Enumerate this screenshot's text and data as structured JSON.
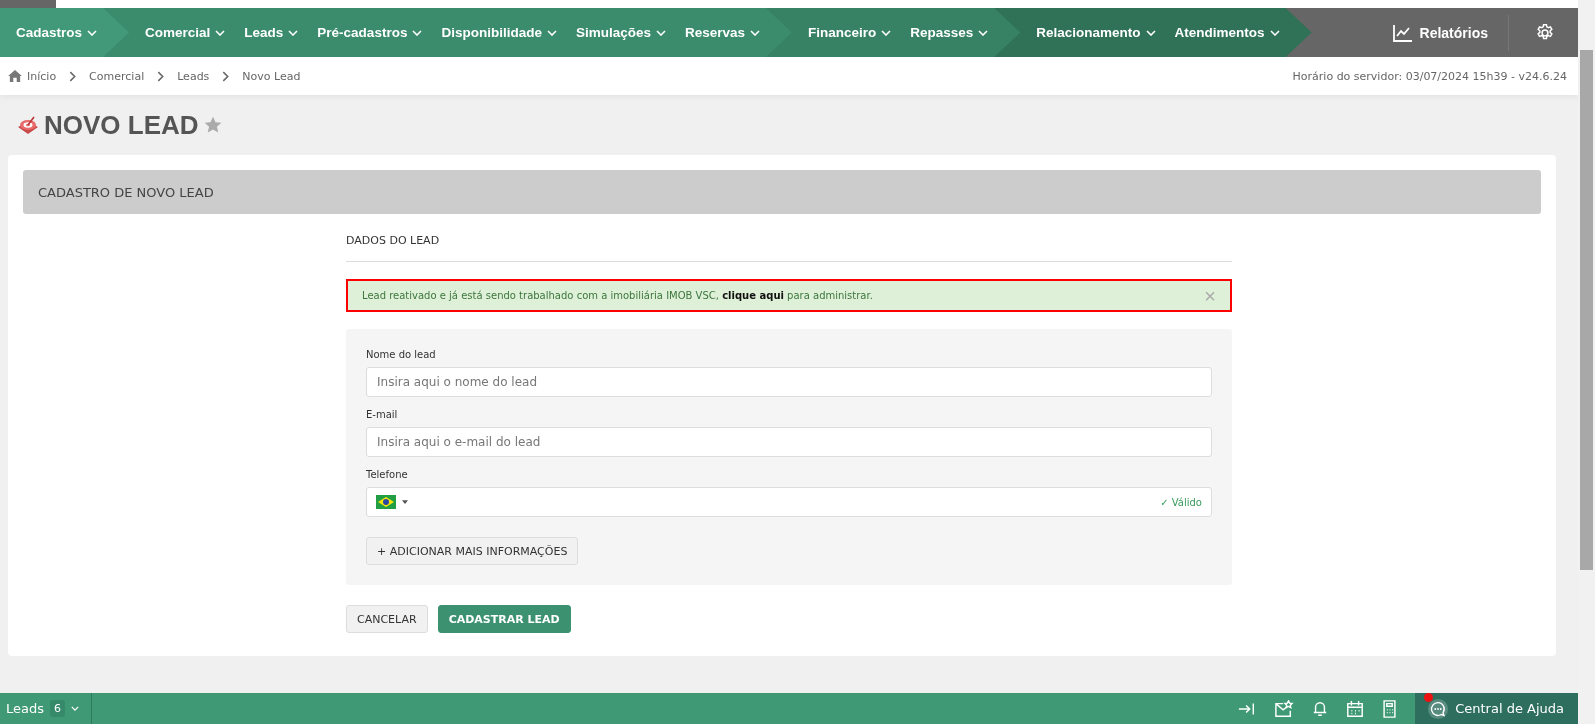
{
  "nav": {
    "groups": [
      {
        "color": "#41997a",
        "items": [
          "Cadastros"
        ]
      },
      {
        "color": "#3b8c6d",
        "items": [
          "Comercial",
          "Leads",
          "Pré-cadastros",
          "Disponibilidade",
          "Simulações",
          "Reservas"
        ]
      },
      {
        "color": "#378164",
        "items": [
          "Financeiro",
          "Repasses"
        ]
      },
      {
        "color": "#2f7257",
        "items": [
          "Relacionamento",
          "Atendimentos"
        ]
      }
    ],
    "reports": "Relatórios"
  },
  "breadcrumb": [
    "Início",
    "Comercial",
    "Leads",
    "Novo Lead"
  ],
  "server_time": "Horário do servidor: 03/07/2024 15h39 - v24.6.24",
  "page_title": "NOVO LEAD",
  "card": {
    "header": "CADASTRO DE NOVO LEAD",
    "section": "DADOS DO LEAD",
    "alert": {
      "before": "Lead reativado e já está sendo trabalhado com a imobiliária IMOB VSC, ",
      "link": "clique aqui",
      "after": " para administrar.",
      "close": "×"
    },
    "fields": [
      {
        "label": "Nome do lead",
        "placeholder": "Insira aqui o nome do lead"
      },
      {
        "label": "E-mail",
        "placeholder": "Insira aqui o e-mail do lead"
      }
    ],
    "phone": {
      "label": "Telefone",
      "status": "✓ Válido"
    },
    "more_button": "+ ADICIONAR MAIS INFORMAÇÕES",
    "cancel": "CANCELAR",
    "submit": "CADASTRAR LEAD"
  },
  "footer": {
    "tab": "Leads",
    "count": "6",
    "help": "Central de Ajuda"
  }
}
